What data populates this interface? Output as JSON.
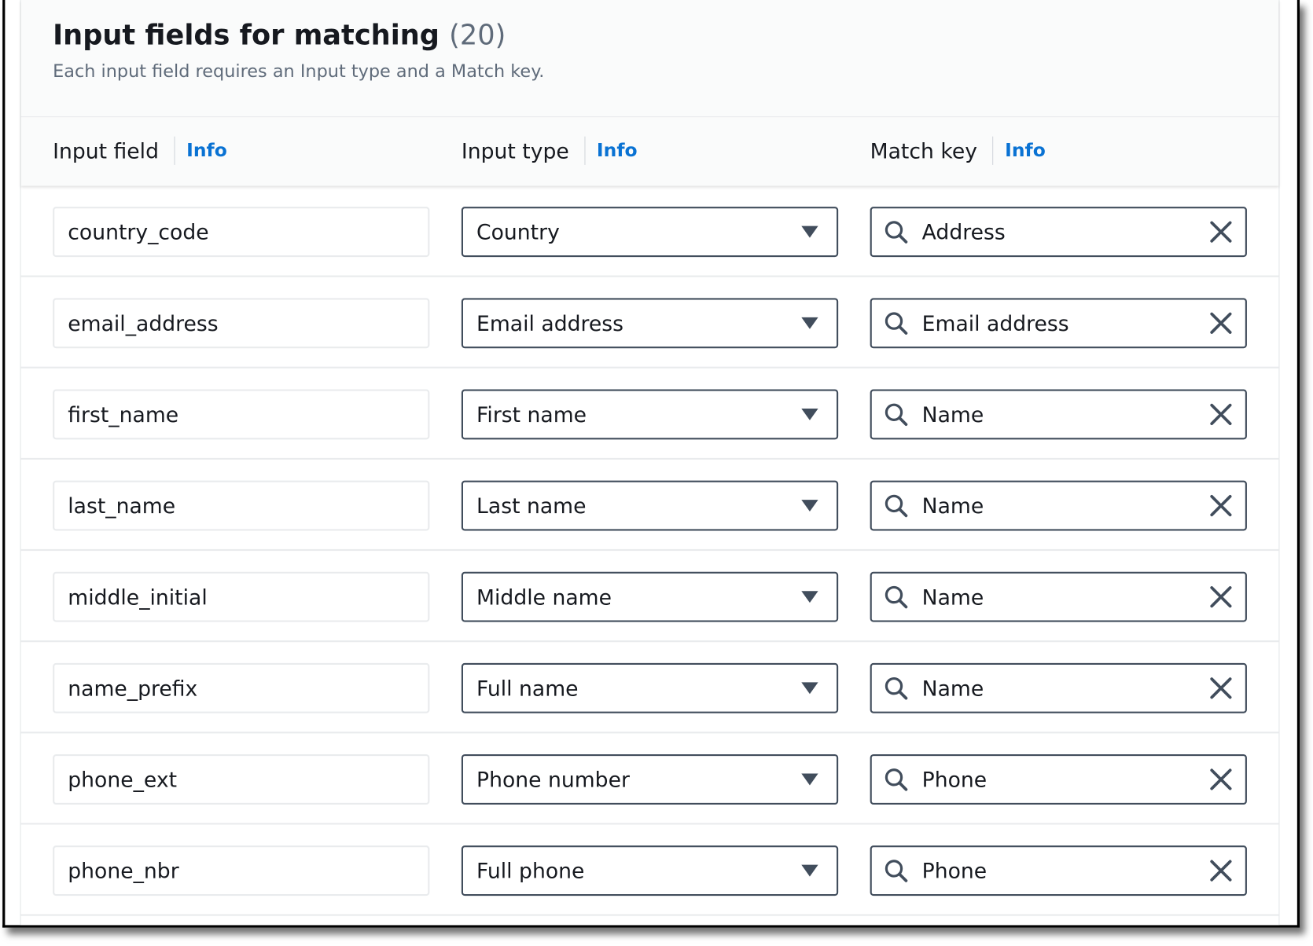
{
  "container": {
    "title": "Input fields for matching",
    "count": "(20)",
    "description": "Each input field requires an Input type and a Match key."
  },
  "columns": {
    "input_field": {
      "label": "Input field",
      "info": "Info"
    },
    "input_type": {
      "label": "Input type",
      "info": "Info"
    },
    "match_key": {
      "label": "Match key",
      "info": "Info"
    }
  },
  "rows": [
    {
      "input_field": "country_code",
      "input_type": "Country",
      "match_key": "Address"
    },
    {
      "input_field": "email_address",
      "input_type": "Email address",
      "match_key": "Email address"
    },
    {
      "input_field": "first_name",
      "input_type": "First name",
      "match_key": "Name"
    },
    {
      "input_field": "last_name",
      "input_type": "Last name",
      "match_key": "Name"
    },
    {
      "input_field": "middle_initial",
      "input_type": "Middle name",
      "match_key": "Name"
    },
    {
      "input_field": "name_prefix",
      "input_type": "Full name",
      "match_key": "Name"
    },
    {
      "input_field": "phone_ext",
      "input_type": "Phone number",
      "match_key": "Phone"
    },
    {
      "input_field": "phone_nbr",
      "input_type": "Full phone",
      "match_key": "Phone"
    }
  ],
  "icons": {
    "select_caret": "caret-down-filled",
    "search": "search-icon",
    "clear": "close-icon"
  },
  "colors": {
    "link": "#0972d3",
    "text": "#16191f",
    "secondary_text": "#5f6b7a",
    "control_border": "#414d5c"
  }
}
